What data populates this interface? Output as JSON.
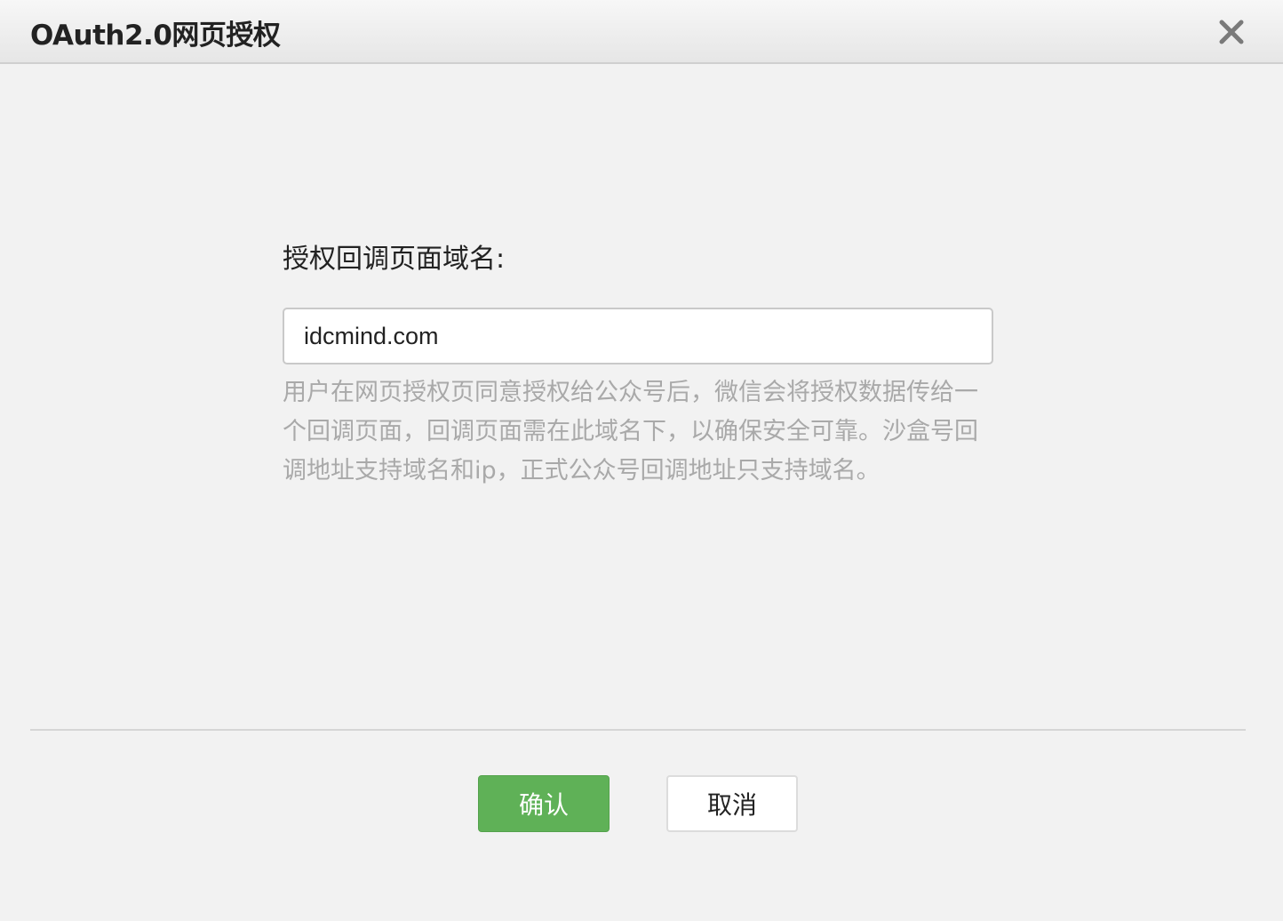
{
  "dialog": {
    "title": "OAuth2.0网页授权",
    "close_icon": "close-icon"
  },
  "form": {
    "label": "授权回调页面域名:",
    "domain_value": "idcmind.com",
    "hint": "用户在网页授权页同意授权给公众号后，微信会将授权数据传给一个回调页面，回调页面需在此域名下，以确保安全可靠。沙盒号回调地址支持域名和ip，正式公众号回调地址只支持域名。"
  },
  "actions": {
    "confirm_label": "确认",
    "cancel_label": "取消"
  },
  "colors": {
    "confirm_bg": "#5fb157",
    "hint_text": "#a9a9a9"
  }
}
